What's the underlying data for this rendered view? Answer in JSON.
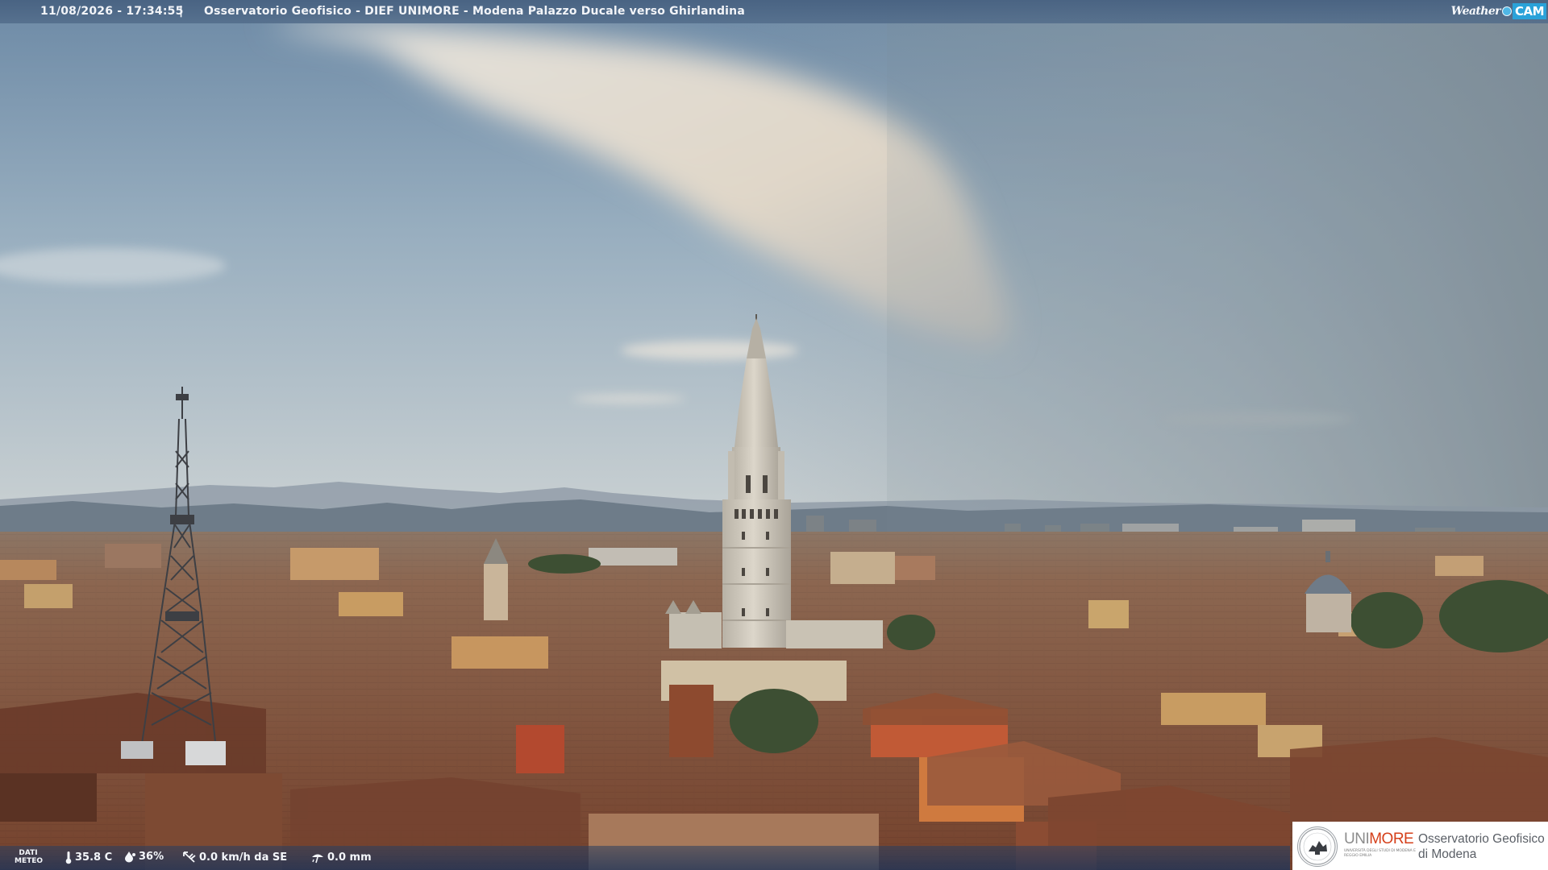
{
  "overlay": {
    "timestamp": "11/08/2026 - 17:34:55",
    "separator": "|",
    "title": "Osservatorio Geofisico - DIEF UNIMORE - Modena Palazzo Ducale verso Ghirlandina",
    "logo": {
      "weather": "Weather",
      "cam": "CAM"
    }
  },
  "weather_bar": {
    "label_line1": "DATI",
    "label_line2": "METEO",
    "temperature": "35.8 C",
    "humidity": "36%",
    "wind": "0.0 km/h da SE",
    "rain": "0.0 mm",
    "icons": [
      "thermometer-icon",
      "humidity-drop-icon",
      "wind-vane-icon",
      "rain-gauge-icon"
    ]
  },
  "watermark": {
    "brand_part1": "UNI",
    "brand_part2": "MORE",
    "subline": "UNIVERSITÀ DEGLI STUDI DI MODENA E REGGIO EMILIA",
    "observatory_line1": "Osservatorio Geofisico",
    "observatory_line2": "di Modena"
  },
  "colors": {
    "sky_top": "#6d8aa6",
    "sky_horizon": "#c6cfd3",
    "haze_right": "#8d9aa3",
    "roofs": "#8a4e34",
    "facades": "#c69a6a",
    "tower_stone": "#cfc9bc",
    "unimore_red": "#d5401b"
  }
}
